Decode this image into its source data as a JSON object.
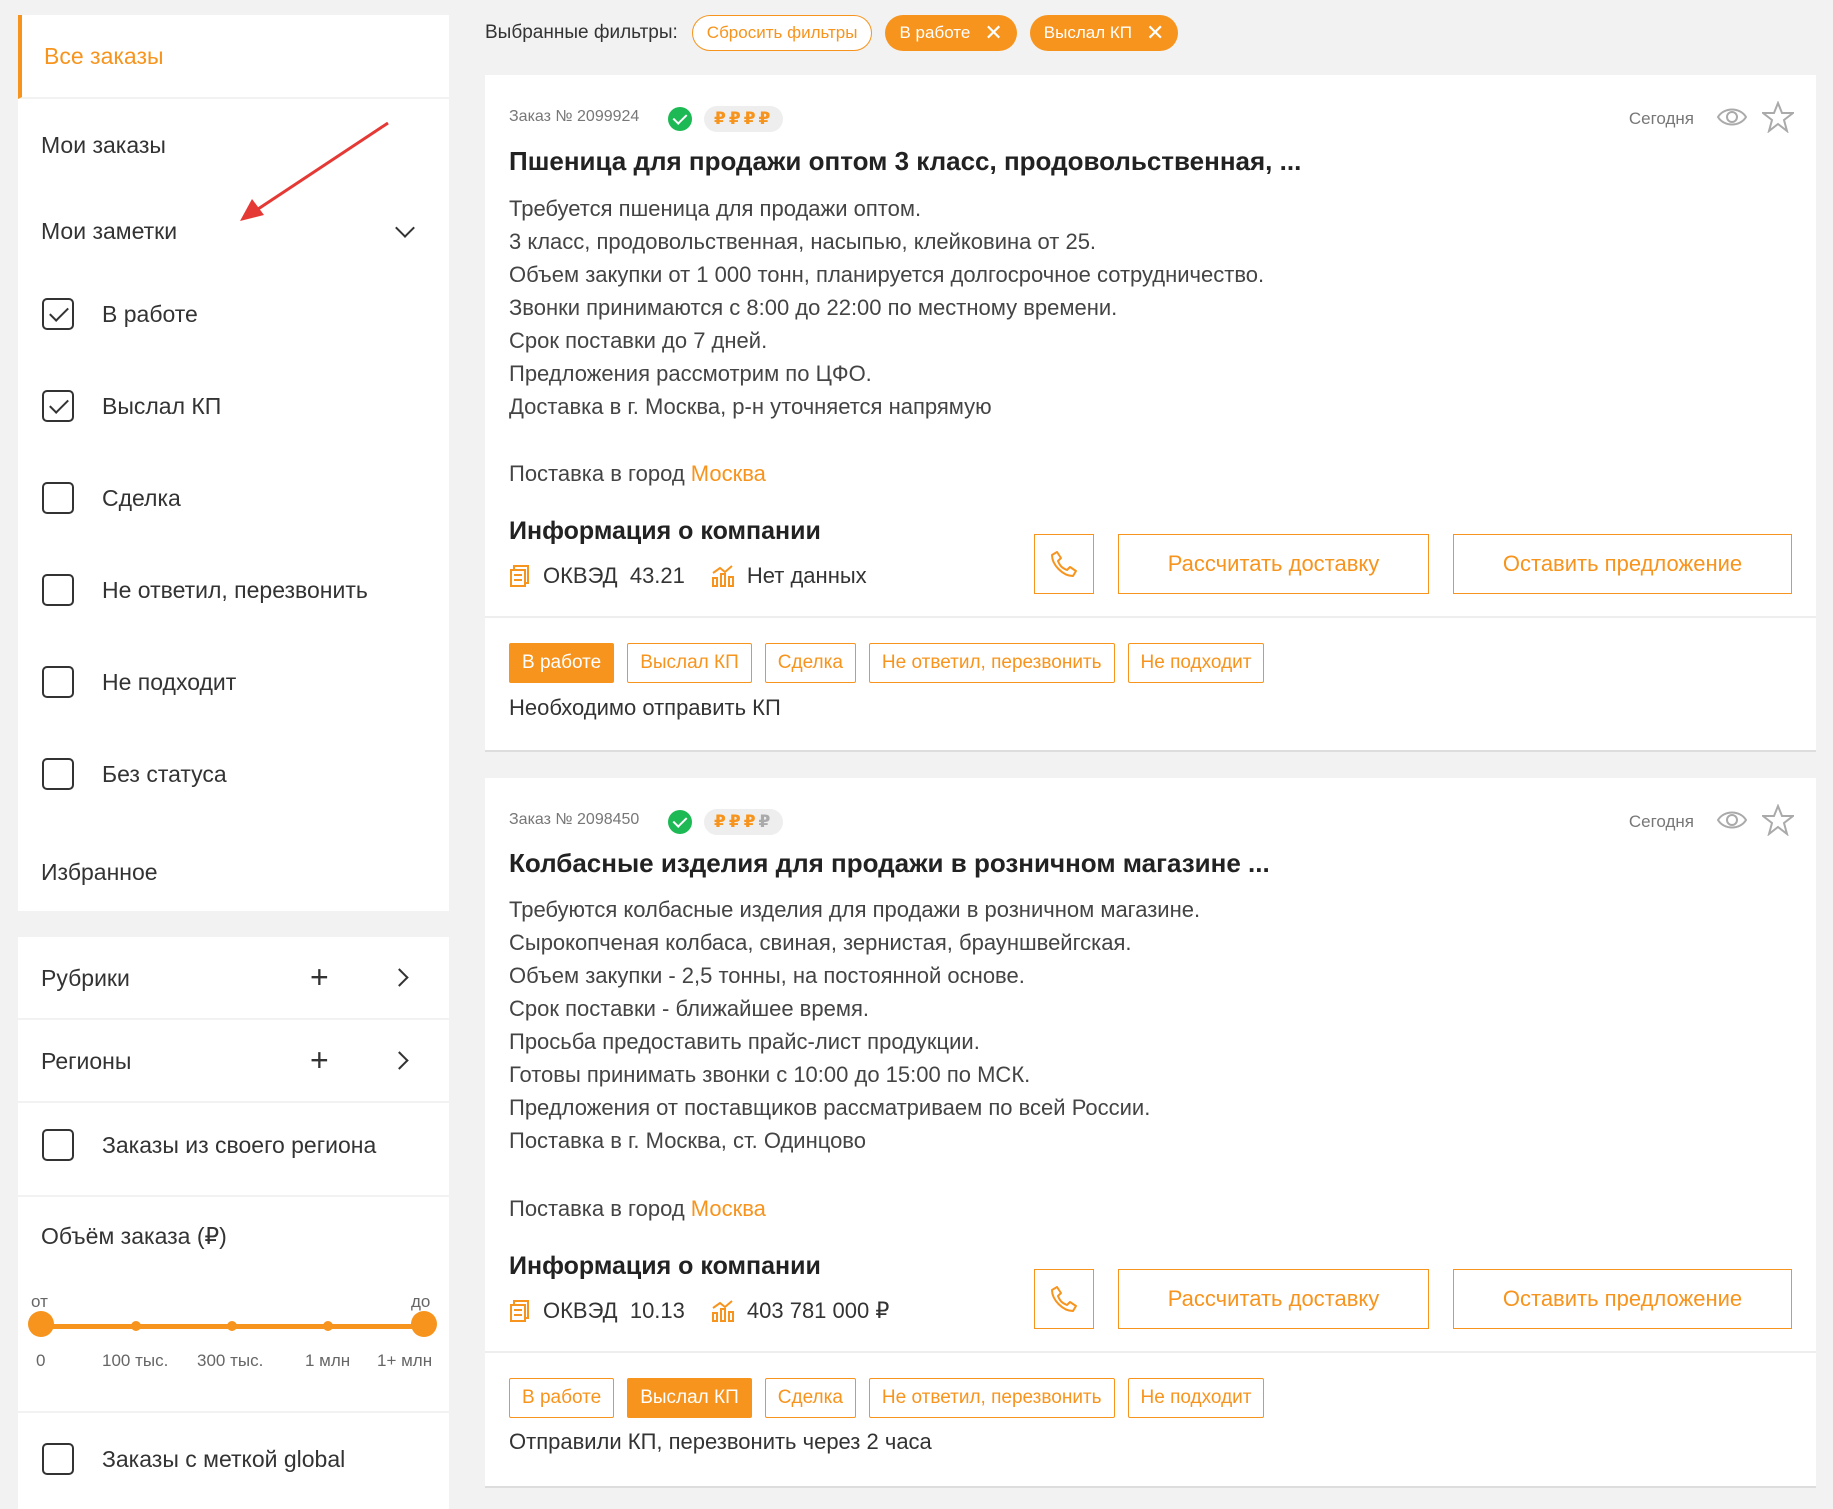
{
  "sidebar": {
    "all_orders": "Все заказы",
    "my_orders": "Мои заказы",
    "my_notes": "Мои заметки",
    "statuses": [
      {
        "label": "В работе",
        "checked": true
      },
      {
        "label": "Выслал КП",
        "checked": true
      },
      {
        "label": "Сделка",
        "checked": false
      },
      {
        "label": "Не ответил, перезвонить",
        "checked": false
      },
      {
        "label": "Не подходит",
        "checked": false
      },
      {
        "label": "Без статуса",
        "checked": false
      }
    ],
    "favorites": "Избранное",
    "rubrics": "Рубрики",
    "regions": "Регионы",
    "own_region": "Заказы из своего региона",
    "volume": {
      "title": "Объём заказа (₽)",
      "from": "от",
      "to": "до",
      "ticks": [
        "0",
        "100 тыс.",
        "300 тыс.",
        "1 млн",
        "1+ млн"
      ]
    },
    "global": "Заказы с меткой global"
  },
  "filters": {
    "label": "Выбранные фильтры:",
    "reset": "Сбросить фильтры",
    "active": [
      "В работе",
      "Выслал КП"
    ],
    "close_glyph": "✕"
  },
  "orders": [
    {
      "order_no": "Заказ № 2099924",
      "rubles_glyph": "₽",
      "date": "Сегодня",
      "title": "Пшеница для продажи оптом 3 класс, продовольственная, ...",
      "description": [
        "Требуется пшеница для продажи оптом.",
        "3 класс, продовольственная, насыпью, клейковина от 25.",
        "Объем закупки от 1 000 тонн, планируется долгосрочное сотрудничество.",
        "Звонки принимаются с 8:00 до 22:00 по местному времени.",
        "Срок поставки до 7 дней.",
        "Предложения рассмотрим по ЦФО.",
        "Доставка в г. Москва, р-н уточняется напрямую"
      ],
      "delivery_prefix": "Поставка в город",
      "delivery_city": "Москва",
      "company_title": "Информация о компании",
      "okved_label": "ОКВЭД",
      "okved": "43.21",
      "revenue": "Нет данных",
      "calc_btn": "Рассчитать доставку",
      "offer_btn": "Оставить предложение",
      "tags": [
        "В работе",
        "Выслал КП",
        "Сделка",
        "Не ответил, перезвонить",
        "Не подходит"
      ],
      "active_tag": "В работе",
      "note": "Необходимо отправить КП"
    },
    {
      "order_no": "Заказ № 2098450",
      "rubles_glyph": "₽",
      "date": "Сегодня",
      "title": "Колбасные изделия для продажи в розничном магазине ...",
      "description": [
        "Требуются колбасные изделия для продажи в розничном магазине.",
        "Сырокопченая колбаса, свиная, зернистая, брауншвейгская.",
        "Объем закупки - 2,5 тонны, на постоянной основе.",
        "Срок поставки - ближайшее время.",
        "Просьба предоставить прайс-лист продукции.",
        "Готовы принимать звонки с 10:00 до 15:00 по МСК.",
        "Предложения от поставщиков рассматриваем по всей России.",
        "Поставка в г. Москва, ст. Одинцово"
      ],
      "delivery_prefix": "Поставка в город",
      "delivery_city": "Москва",
      "company_title": "Информация о компании",
      "okved_label": "ОКВЭД",
      "okved": "10.13",
      "revenue": "403 781 000 ₽",
      "calc_btn": "Рассчитать доставку",
      "offer_btn": "Оставить предложение",
      "tags": [
        "В работе",
        "Выслал КП",
        "Сделка",
        "Не ответил, перезвонить",
        "Не подходит"
      ],
      "active_tag": "Выслал КП",
      "note": "Отправили КП, перезвонить через 2 часа"
    }
  ],
  "colors": {
    "accent": "#f7941d",
    "verified": "#1db954",
    "annotation_arrow": "#e53935"
  },
  "icons": [
    "check-icon",
    "verified-check-icon",
    "eye-icon",
    "star-icon",
    "phone-icon",
    "document-icon",
    "growth-chart-icon",
    "plus-icon",
    "chevron-right-icon",
    "chevron-down-icon",
    "close-icon",
    "arrow-annotation"
  ]
}
